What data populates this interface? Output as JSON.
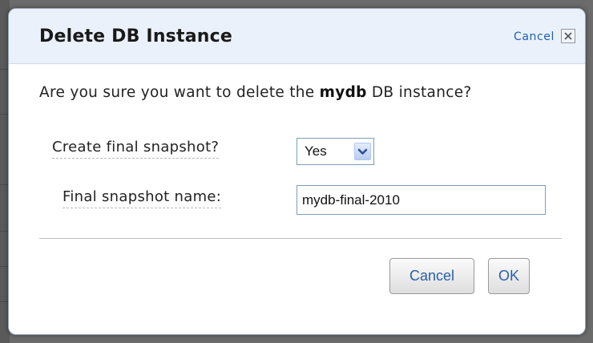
{
  "dialog": {
    "title": "Delete DB Instance",
    "header_cancel_label": "Cancel",
    "close_icon": "close-x-icon"
  },
  "message": {
    "prefix": "Are you sure you want to delete the ",
    "instance_name": "mydb",
    "suffix": " DB instance?"
  },
  "form": {
    "snapshot_label": "Create final snapshot?",
    "snapshot_value": "Yes",
    "snapshot_options": [
      "Yes"
    ],
    "name_label": "Final snapshot name:",
    "name_value": "mydb-final-2010"
  },
  "buttons": {
    "cancel_label": "Cancel",
    "ok_label": "OK"
  },
  "colors": {
    "header_bg": "#eaf1fb",
    "link": "#1f5fb5",
    "button_text": "#2a5ea8",
    "input_border": "#7f9db9"
  }
}
